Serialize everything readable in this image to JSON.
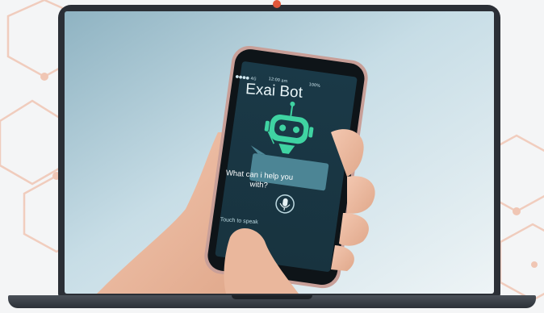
{
  "phone": {
    "status_left": "●●●● 4G",
    "status_time": "12:00 am",
    "status_battery": "100%",
    "app_title": "Exai Bot",
    "bubble_text": "What can i help you with?",
    "speak_label": "Touch to speak"
  },
  "icons": [
    "robot-icon",
    "microphone-icon",
    "battery-icon",
    "signal-icon"
  ],
  "colors": {
    "accent_webcam": "#e1573b",
    "robot_green": "#3fd3a2",
    "phone_screen": "#1d3d4a",
    "laptop_frame": "#2b2f36"
  }
}
